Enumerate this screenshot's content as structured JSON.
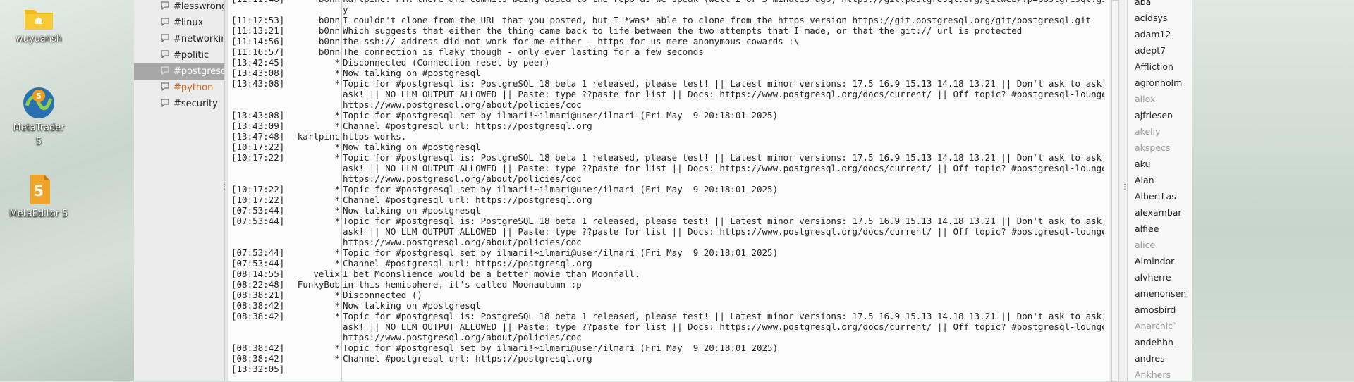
{
  "desktop": {
    "icons": [
      {
        "name": "folder",
        "label": "wuyuansh"
      },
      {
        "name": "metatrader",
        "label_lines": [
          "MetaTrader",
          "5"
        ]
      },
      {
        "name": "metaeditor",
        "label": "MetaEditor 5"
      }
    ]
  },
  "channels": [
    {
      "name": "#lesswrong",
      "selected": false
    },
    {
      "name": "#linux",
      "selected": false
    },
    {
      "name": "#networking",
      "selected": false
    },
    {
      "name": "#politic",
      "selected": false
    },
    {
      "name": "#postgresql",
      "selected": true
    },
    {
      "name": "#python",
      "selected": false,
      "highlight": true
    },
    {
      "name": "#security",
      "selected": false
    }
  ],
  "colors": {
    "highlight": "#c8641b",
    "selected_bg": "#a7a7a7"
  },
  "messages": [
    {
      "ts": "[11:11:48]",
      "nick": "b0nn",
      "msg": "karlpinc: FTR there are commits being added to the repo as we speak (well 2 or 3 minutes ago) https://git.postgresql.org/gitweb/?p=postgresql.git;a=summar"
    },
    {
      "ts": "",
      "nick": "",
      "msg": "y"
    },
    {
      "ts": "[11:12:53]",
      "nick": "b0nn",
      "msg": "I couldn't clone from the URL that you posted, but I *was* able to clone from the https version https://git.postgresql.org/git/postgresql.git"
    },
    {
      "ts": "[11:13:21]",
      "nick": "b0nn",
      "msg": "Which suggests that either the thing came back to life between the two attempts that I made, or that the git:// url is protected"
    },
    {
      "ts": "[11:14:56]",
      "nick": "b0nn",
      "msg": "the ssh:// address did not work for me either - https for us mere anonymous cowards :\\"
    },
    {
      "ts": "[11:16:57]",
      "nick": "b0nn",
      "msg": "The connection is flaky though - only ever lasting for a few seconds"
    },
    {
      "ts": "[13:42:45]",
      "nick": "*",
      "msg": "Disconnected (Connection reset by peer)"
    },
    {
      "ts": "[13:43:08]",
      "nick": "*",
      "msg": "Now talking on #postgresql"
    },
    {
      "ts": "[13:43:08]",
      "nick": "*",
      "msg": "Topic for #postgresql is: PostgreSQL 18 beta 1 released, please test! || Latest minor versions: 17.5 16.9 15.13 14.18 13.21 || Don't ask to ask; just"
    },
    {
      "ts": "",
      "nick": "",
      "msg": "ask! || NO LLM OUTPUT ALLOWED || Paste: type ??paste for list || Docs: https://www.postgresql.org/docs/current/ || Off topic? #postgresql-lounge || CoC:"
    },
    {
      "ts": "",
      "nick": "",
      "msg": "https://www.postgresql.org/about/policies/coc"
    },
    {
      "ts": "[13:43:08]",
      "nick": "*",
      "msg": "Topic for #postgresql set by ilmari!~ilmari@user/ilmari (Fri May  9 20:18:01 2025)"
    },
    {
      "ts": "[13:43:09]",
      "nick": "*",
      "msg": "Channel #postgresql url: https://postgresql.org"
    },
    {
      "ts": "[13:47:48]",
      "nick": "karlpinc",
      "msg": "https works."
    },
    {
      "ts": "[10:17:22]",
      "nick": "*",
      "msg": "Now talking on #postgresql"
    },
    {
      "ts": "[10:17:22]",
      "nick": "*",
      "msg": "Topic for #postgresql is: PostgreSQL 18 beta 1 released, please test! || Latest minor versions: 17.5 16.9 15.13 14.18 13.21 || Don't ask to ask; just"
    },
    {
      "ts": "",
      "nick": "",
      "msg": "ask! || NO LLM OUTPUT ALLOWED || Paste: type ??paste for list || Docs: https://www.postgresql.org/docs/current/ || Off topic? #postgresql-lounge || CoC:"
    },
    {
      "ts": "",
      "nick": "",
      "msg": "https://www.postgresql.org/about/policies/coc"
    },
    {
      "ts": "[10:17:22]",
      "nick": "*",
      "msg": "Topic for #postgresql set by ilmari!~ilmari@user/ilmari (Fri May  9 20:18:01 2025)"
    },
    {
      "ts": "[10:17:22]",
      "nick": "*",
      "msg": "Channel #postgresql url: https://postgresql.org"
    },
    {
      "ts": "[07:53:44]",
      "nick": "*",
      "msg": "Now talking on #postgresql"
    },
    {
      "ts": "[07:53:44]",
      "nick": "*",
      "msg": "Topic for #postgresql is: PostgreSQL 18 beta 1 released, please test! || Latest minor versions: 17.5 16.9 15.13 14.18 13.21 || Don't ask to ask; just"
    },
    {
      "ts": "",
      "nick": "",
      "msg": "ask! || NO LLM OUTPUT ALLOWED || Paste: type ??paste for list || Docs: https://www.postgresql.org/docs/current/ || Off topic? #postgresql-lounge || CoC:"
    },
    {
      "ts": "",
      "nick": "",
      "msg": "https://www.postgresql.org/about/policies/coc"
    },
    {
      "ts": "[07:53:44]",
      "nick": "*",
      "msg": "Topic for #postgresql set by ilmari!~ilmari@user/ilmari (Fri May  9 20:18:01 2025)"
    },
    {
      "ts": "[07:53:44]",
      "nick": "*",
      "msg": "Channel #postgresql url: https://postgresql.org"
    },
    {
      "ts": "[08:14:55]",
      "nick": "velix",
      "msg": "I bet Moonslience would be a better movie than Moonfall."
    },
    {
      "ts": "[08:22:48]",
      "nick": "FunkyBob",
      "msg": "in this hemisphere, it's called Moonautumn :p"
    },
    {
      "ts": "[08:38:21]",
      "nick": "*",
      "msg": "Disconnected ()"
    },
    {
      "ts": "[08:38:42]",
      "nick": "*",
      "msg": "Now talking on #postgresql"
    },
    {
      "ts": "[08:38:42]",
      "nick": "*",
      "msg": "Topic for #postgresql is: PostgreSQL 18 beta 1 released, please test! || Latest minor versions: 17.5 16.9 15.13 14.18 13.21 || Don't ask to ask; just"
    },
    {
      "ts": "",
      "nick": "",
      "msg": "ask! || NO LLM OUTPUT ALLOWED || Paste: type ??paste for list || Docs: https://www.postgresql.org/docs/current/ || Off topic? #postgresql-lounge || CoC:"
    },
    {
      "ts": "",
      "nick": "",
      "msg": "https://www.postgresql.org/about/policies/coc"
    },
    {
      "ts": "[08:38:42]",
      "nick": "*",
      "msg": "Topic for #postgresql set by ilmari!~ilmari@user/ilmari (Fri May  9 20:18:01 2025)"
    },
    {
      "ts": "[08:38:42]",
      "nick": "*",
      "msg": "Channel #postgresql url: https://postgresql.org"
    },
    {
      "ts": "[13:32:05]",
      "nick": "",
      "msg": ""
    }
  ],
  "users": [
    {
      "name": "aba",
      "away": false
    },
    {
      "name": "acidsys",
      "away": false
    },
    {
      "name": "adam12",
      "away": false
    },
    {
      "name": "adept7",
      "away": false
    },
    {
      "name": "Affliction",
      "away": false
    },
    {
      "name": "agronholm",
      "away": false
    },
    {
      "name": "ailox",
      "away": true
    },
    {
      "name": "ajfriesen",
      "away": false
    },
    {
      "name": "akelly",
      "away": true
    },
    {
      "name": "akspecs",
      "away": true
    },
    {
      "name": "aku",
      "away": false
    },
    {
      "name": "Alan",
      "away": false
    },
    {
      "name": "AlbertLas",
      "away": false
    },
    {
      "name": "alexambar",
      "away": false
    },
    {
      "name": "alfiee",
      "away": false
    },
    {
      "name": "alice",
      "away": true
    },
    {
      "name": "Almindor",
      "away": false
    },
    {
      "name": "alvherre",
      "away": false
    },
    {
      "name": "amenonsen",
      "away": false
    },
    {
      "name": "amosbird",
      "away": false
    },
    {
      "name": "Anarchic`",
      "away": true
    },
    {
      "name": "andehhh_",
      "away": false
    },
    {
      "name": "andres",
      "away": false
    },
    {
      "name": "Ankhers",
      "away": true
    }
  ]
}
